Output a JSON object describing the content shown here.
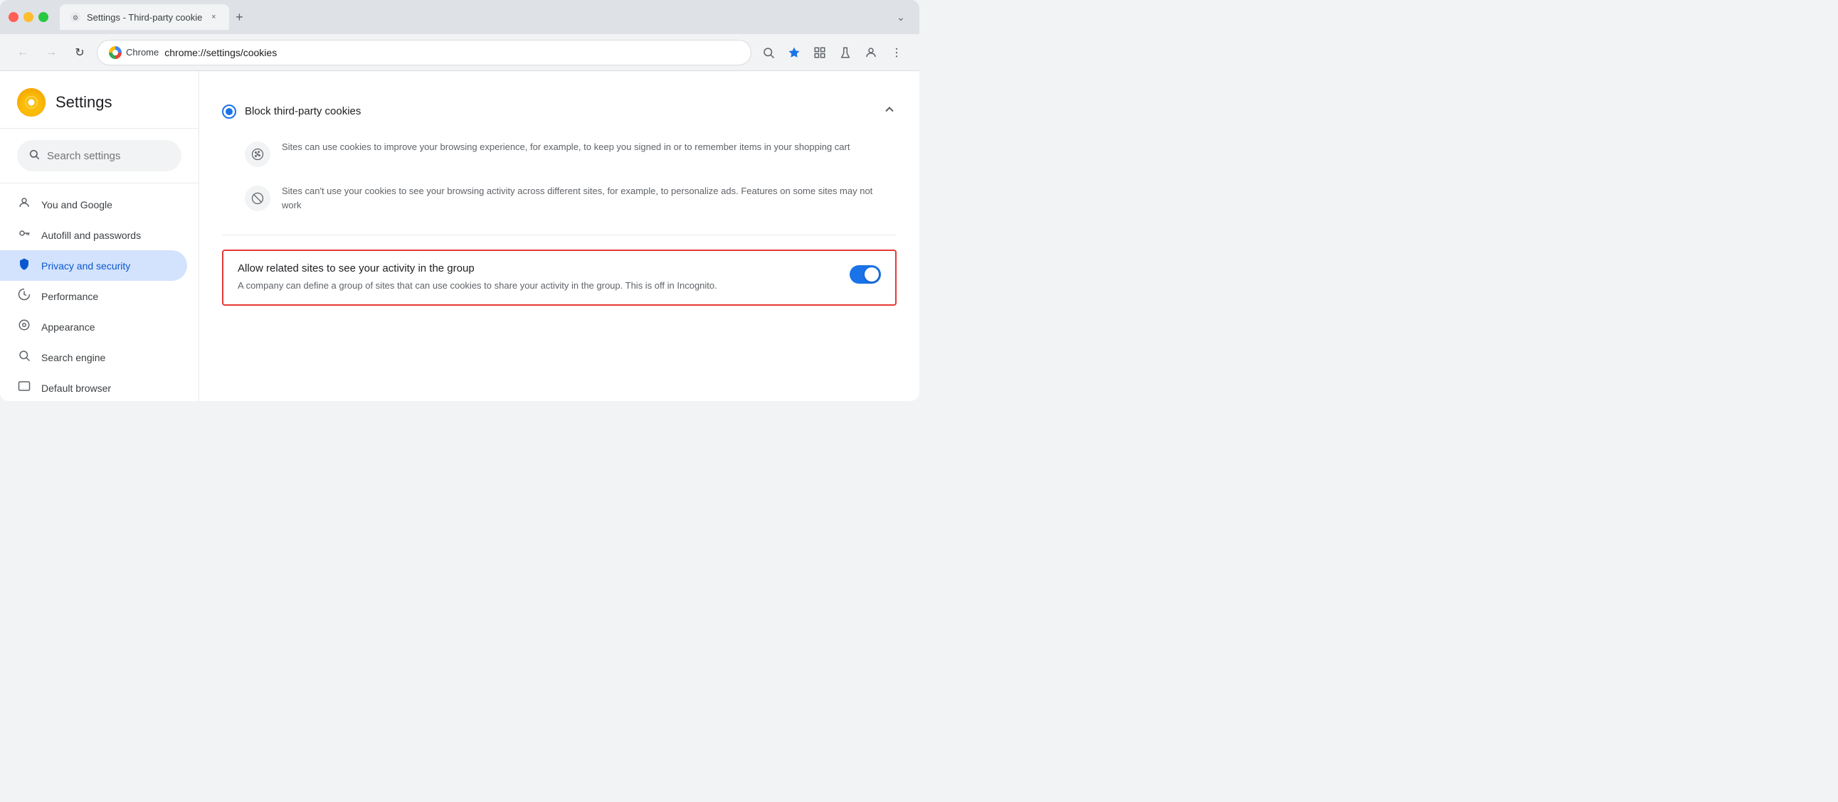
{
  "browser": {
    "tab_title": "Settings - Third-party cookie",
    "tab_close": "×",
    "new_tab": "+",
    "window_dropdown": "⌄",
    "address": "chrome://settings/cookies",
    "chrome_label": "Chrome",
    "nav_back": "←",
    "nav_forward": "→",
    "nav_refresh": "↻"
  },
  "settings": {
    "logo_text": "⚙",
    "title": "Settings",
    "search_placeholder": "Search settings",
    "nav_items": [
      {
        "id": "you-and-google",
        "icon": "👤",
        "label": "You and Google",
        "active": false
      },
      {
        "id": "autofill",
        "icon": "🔑",
        "label": "Autofill and passwords",
        "active": false
      },
      {
        "id": "privacy",
        "icon": "🛡",
        "label": "Privacy and security",
        "active": true
      },
      {
        "id": "performance",
        "icon": "📈",
        "label": "Performance",
        "active": false
      },
      {
        "id": "appearance",
        "icon": "🎨",
        "label": "Appearance",
        "active": false
      },
      {
        "id": "search-engine",
        "icon": "🔍",
        "label": "Search engine",
        "active": false
      },
      {
        "id": "default-browser",
        "icon": "⬜",
        "label": "Default browser",
        "active": false
      }
    ]
  },
  "content": {
    "block_cookies": {
      "title": "Block third-party cookies",
      "selected": true,
      "detail1": {
        "icon": "🍪",
        "text": "Sites can use cookies to improve your browsing experience, for example, to keep you signed in or to remember items in your shopping cart"
      },
      "detail2": {
        "icon": "⊘",
        "text": "Sites can't use your cookies to see your browsing activity across different sites, for example, to personalize ads. Features on some sites may not work"
      }
    },
    "allow_related": {
      "title": "Allow related sites to see your activity in the group",
      "description": "A company can define a group of sites that can use cookies to share your activity in the group. This is off in Incognito.",
      "toggle_on": true
    }
  }
}
